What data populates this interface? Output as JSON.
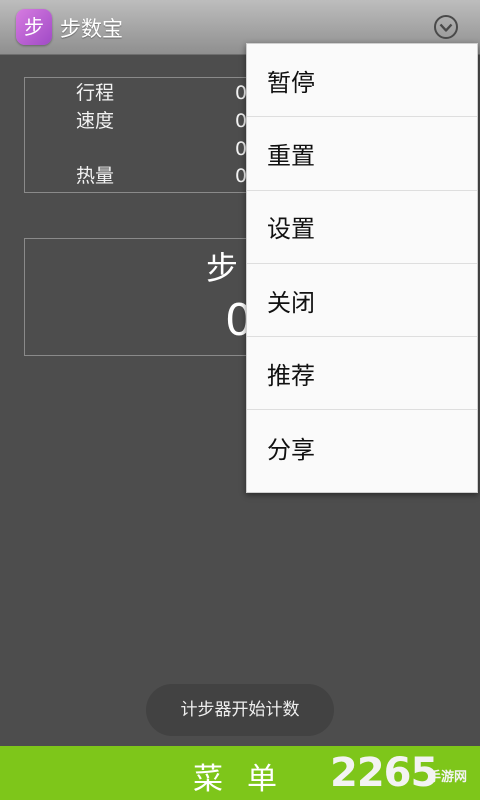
{
  "title_bar": {
    "app_icon_glyph": "步",
    "app_title": "步数宝",
    "overflow_icon": "circle-chevron-down-icon"
  },
  "stats": {
    "distance_label": "行程",
    "distance_value": "0",
    "speed_label": "速度",
    "speed_value": "0",
    "unlabeled_value": "0",
    "calories_label": "热量",
    "calories_value": "0"
  },
  "steps": {
    "label": "步",
    "value": "0"
  },
  "menu": {
    "items": [
      "暂停",
      "重置",
      "设置",
      "关闭",
      "推荐",
      "分享"
    ]
  },
  "toast": "计步器开始计数",
  "bottom_bar": {
    "label": "菜单",
    "color": "#7ec61a"
  },
  "watermark": {
    "text": "2265",
    "suffix": "手游网"
  }
}
